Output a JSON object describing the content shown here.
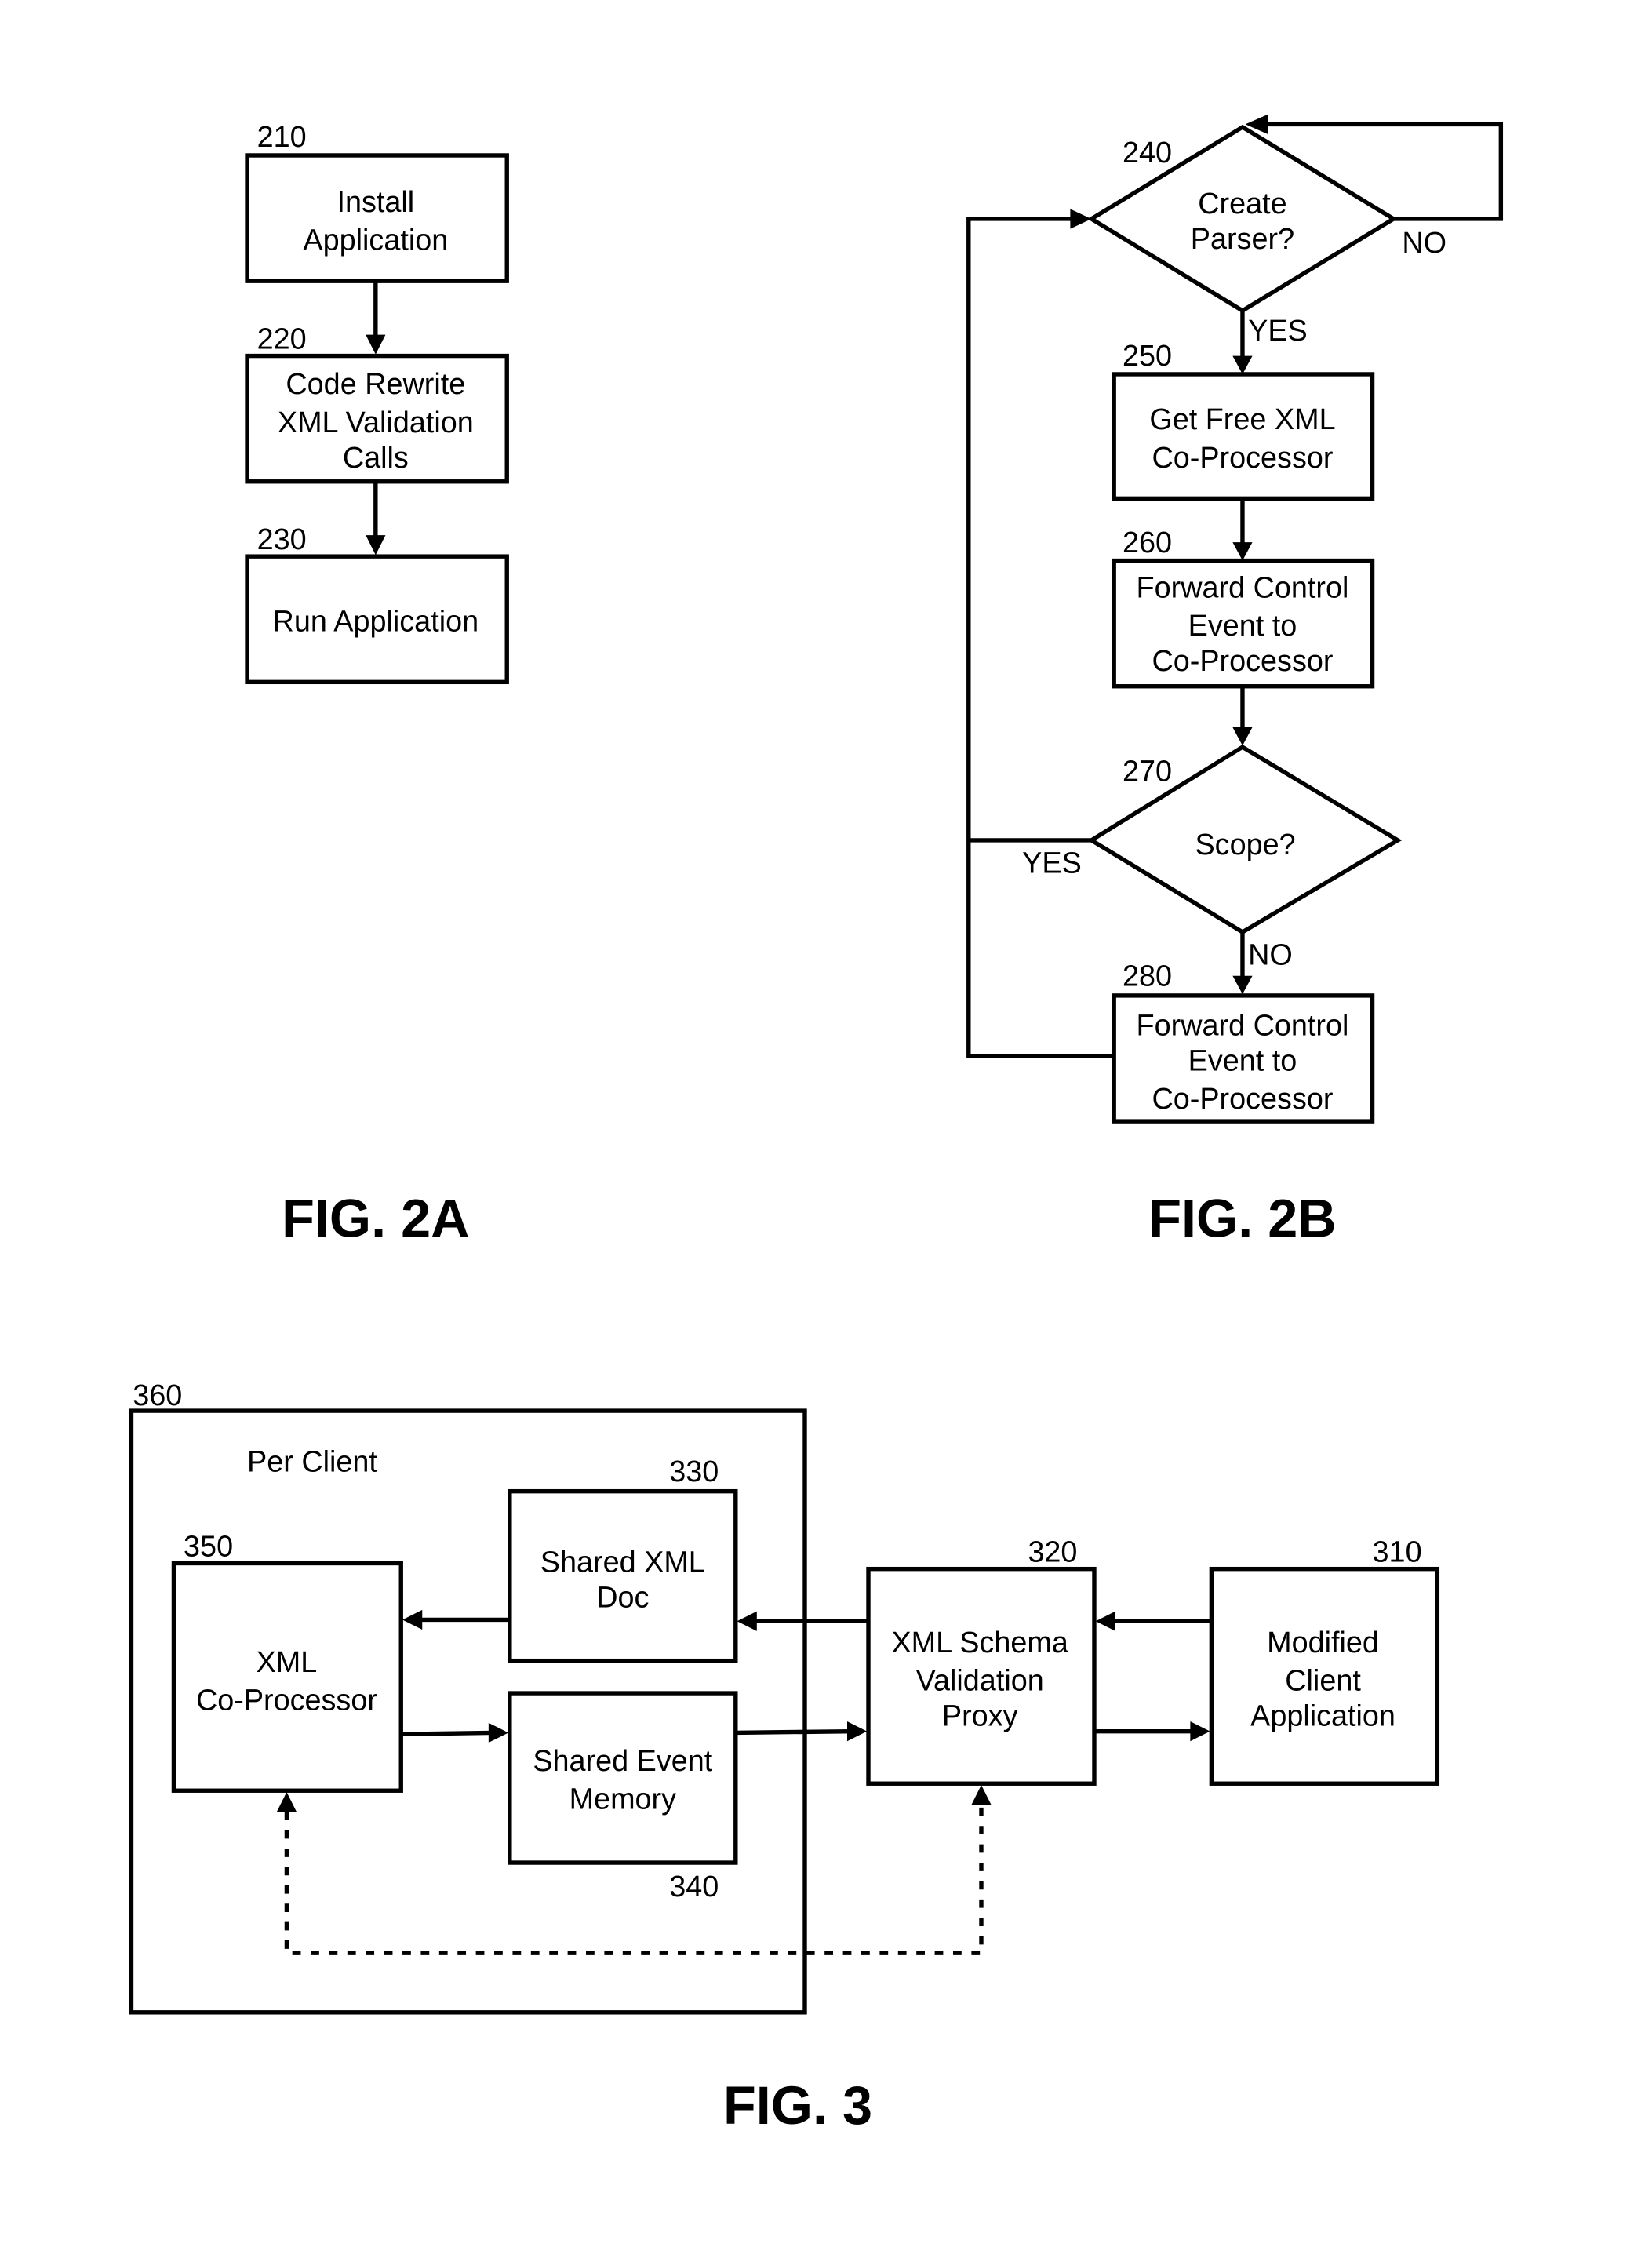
{
  "fig2a": {
    "caption": "FIG. 2A",
    "steps": [
      {
        "ref": "210",
        "lines": [
          "Install",
          "Application"
        ]
      },
      {
        "ref": "220",
        "lines": [
          "Code Rewrite",
          "XML Validation",
          "Calls"
        ]
      },
      {
        "ref": "230",
        "lines": [
          "Run Application"
        ]
      }
    ]
  },
  "fig2b": {
    "caption": "FIG. 2B",
    "decision_240": {
      "ref": "240",
      "lines": [
        "Create",
        "Parser?"
      ],
      "yes": "YES",
      "no": "NO"
    },
    "step_250": {
      "ref": "250",
      "lines": [
        "Get Free XML",
        "Co-Processor"
      ]
    },
    "step_260": {
      "ref": "260",
      "lines": [
        "Forward Control",
        "Event to",
        "Co-Processor"
      ]
    },
    "decision_270": {
      "ref": "270",
      "lines": [
        "Scope?"
      ],
      "yes": "YES",
      "no": "NO"
    },
    "step_280": {
      "ref": "280",
      "lines": [
        "Forward Control",
        "Event to",
        "Co-Processor"
      ]
    }
  },
  "fig3": {
    "caption": "FIG. 3",
    "container": {
      "ref": "360",
      "label": "Per Client"
    },
    "coprocessor": {
      "ref": "350",
      "lines": [
        "XML",
        "Co-Processor"
      ]
    },
    "shared_doc": {
      "ref": "330",
      "lines": [
        "Shared XML",
        "Doc"
      ]
    },
    "shared_event": {
      "ref": "340",
      "lines": [
        "Shared Event",
        "Memory"
      ]
    },
    "proxy": {
      "ref": "320",
      "lines": [
        "XML Schema",
        "Validation",
        "Proxy"
      ]
    },
    "client_app": {
      "ref": "310",
      "lines": [
        "Modified",
        "Client",
        "Application"
      ]
    }
  }
}
